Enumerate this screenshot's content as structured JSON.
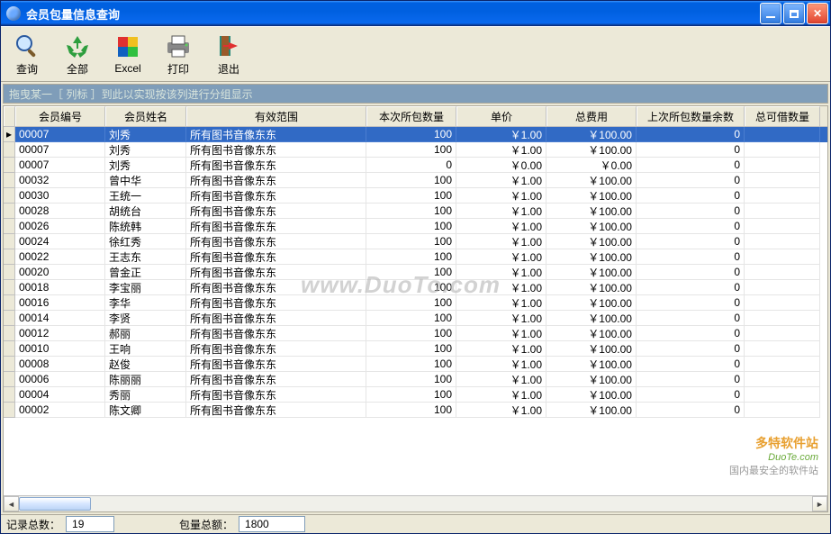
{
  "window": {
    "title": "会员包量信息查询"
  },
  "toolbar": {
    "search": "查询",
    "all": "全部",
    "excel": "Excel",
    "print": "打印",
    "exit": "退出"
  },
  "groupbar": {
    "text": "拖曳某一［ 列标 ］到此以实现按该列进行分组显示"
  },
  "columns": {
    "c0": "会员编号",
    "c1": "会员姓名",
    "c2": "有效范围",
    "c3": "本次所包数量",
    "c4": "单价",
    "c5": "总费用",
    "c6": "上次所包数量余数",
    "c7": "总可借数量"
  },
  "rows": [
    {
      "id": "00007",
      "name": "刘秀",
      "scope": "所有图书音像东东",
      "qty": "100",
      "price": "￥1.00",
      "total": "￥100.00",
      "prev": "0",
      "sel": true
    },
    {
      "id": "00007",
      "name": "刘秀",
      "scope": "所有图书音像东东",
      "qty": "100",
      "price": "￥1.00",
      "total": "￥100.00",
      "prev": "0"
    },
    {
      "id": "00007",
      "name": "刘秀",
      "scope": "所有图书音像东东",
      "qty": "0",
      "price": "￥0.00",
      "total": "￥0.00",
      "prev": "0"
    },
    {
      "id": "00032",
      "name": "曾中华",
      "scope": "所有图书音像东东",
      "qty": "100",
      "price": "￥1.00",
      "total": "￥100.00",
      "prev": "0"
    },
    {
      "id": "00030",
      "name": "王统一",
      "scope": "所有图书音像东东",
      "qty": "100",
      "price": "￥1.00",
      "total": "￥100.00",
      "prev": "0"
    },
    {
      "id": "00028",
      "name": "胡统台",
      "scope": "所有图书音像东东",
      "qty": "100",
      "price": "￥1.00",
      "total": "￥100.00",
      "prev": "0"
    },
    {
      "id": "00026",
      "name": "陈统韩",
      "scope": "所有图书音像东东",
      "qty": "100",
      "price": "￥1.00",
      "total": "￥100.00",
      "prev": "0"
    },
    {
      "id": "00024",
      "name": "徐红秀",
      "scope": "所有图书音像东东",
      "qty": "100",
      "price": "￥1.00",
      "total": "￥100.00",
      "prev": "0"
    },
    {
      "id": "00022",
      "name": "王志东",
      "scope": "所有图书音像东东",
      "qty": "100",
      "price": "￥1.00",
      "total": "￥100.00",
      "prev": "0"
    },
    {
      "id": "00020",
      "name": "曾金正",
      "scope": "所有图书音像东东",
      "qty": "100",
      "price": "￥1.00",
      "total": "￥100.00",
      "prev": "0"
    },
    {
      "id": "00018",
      "name": "李宝丽",
      "scope": "所有图书音像东东",
      "qty": "100",
      "price": "￥1.00",
      "total": "￥100.00",
      "prev": "0"
    },
    {
      "id": "00016",
      "name": "李华",
      "scope": "所有图书音像东东",
      "qty": "100",
      "price": "￥1.00",
      "total": "￥100.00",
      "prev": "0"
    },
    {
      "id": "00014",
      "name": "李贤",
      "scope": "所有图书音像东东",
      "qty": "100",
      "price": "￥1.00",
      "total": "￥100.00",
      "prev": "0"
    },
    {
      "id": "00012",
      "name": "郝丽",
      "scope": "所有图书音像东东",
      "qty": "100",
      "price": "￥1.00",
      "total": "￥100.00",
      "prev": "0"
    },
    {
      "id": "00010",
      "name": "王响",
      "scope": "所有图书音像东东",
      "qty": "100",
      "price": "￥1.00",
      "total": "￥100.00",
      "prev": "0"
    },
    {
      "id": "00008",
      "name": "赵俊",
      "scope": "所有图书音像东东",
      "qty": "100",
      "price": "￥1.00",
      "total": "￥100.00",
      "prev": "0"
    },
    {
      "id": "00006",
      "name": "陈丽丽",
      "scope": "所有图书音像东东",
      "qty": "100",
      "price": "￥1.00",
      "total": "￥100.00",
      "prev": "0"
    },
    {
      "id": "00004",
      "name": "秀丽",
      "scope": "所有图书音像东东",
      "qty": "100",
      "price": "￥1.00",
      "total": "￥100.00",
      "prev": "0"
    },
    {
      "id": "00002",
      "name": "陈文卿",
      "scope": "所有图书音像东东",
      "qty": "100",
      "price": "￥1.00",
      "total": "￥100.00",
      "prev": "0"
    }
  ],
  "watermark": "www.DuoTo.com",
  "duote": {
    "l1": "多特软件站",
    "l2": "DuoTe.com",
    "l3": "国内最安全的软件站"
  },
  "status": {
    "records_label": "记录总数：",
    "records_value": "19",
    "amount_label": "包量总额：",
    "amount_value": "1800"
  }
}
